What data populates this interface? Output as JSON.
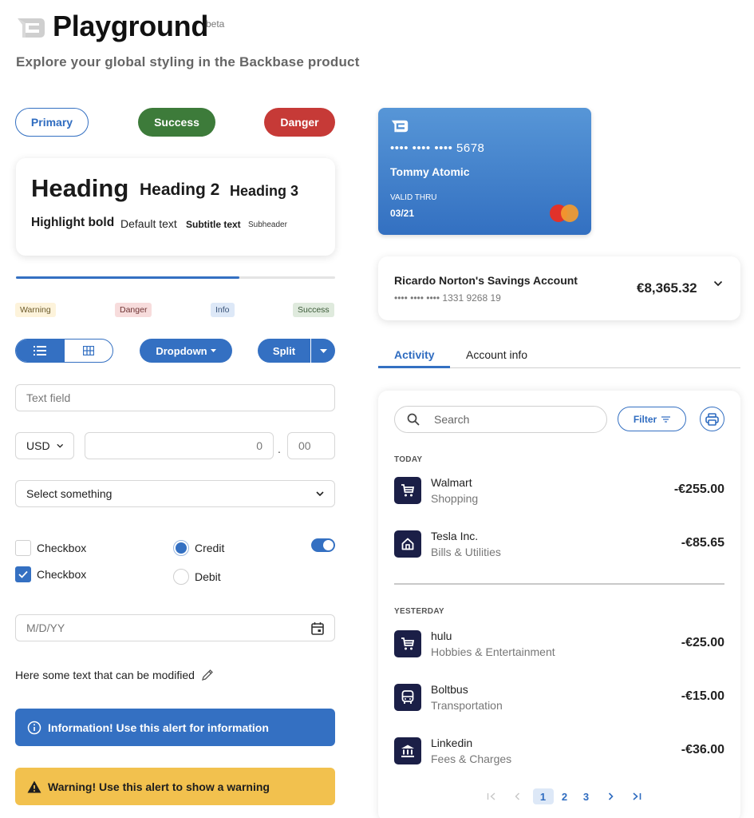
{
  "header": {
    "title": "Playground",
    "badge": "beta",
    "subtitle": "Explore your global styling in the Backbase product"
  },
  "buttons": {
    "primary": "Primary",
    "success": "Success",
    "danger": "Danger"
  },
  "typography": {
    "heading": "Heading",
    "heading2": "Heading 2",
    "heading3": "Heading 3",
    "highlight": "Highlight bold",
    "default": "Default text",
    "subtitle": "Subtitle text",
    "subheader": "Subheader"
  },
  "progress": {
    "value_percent": 70
  },
  "badges": {
    "warning": "Warning",
    "danger": "Danger",
    "info": "Info",
    "success": "Success"
  },
  "controls": {
    "view_toggle": {
      "options": [
        "list-icon",
        "grid-icon"
      ],
      "selected": "list-icon"
    },
    "dropdown_label": "Dropdown",
    "split_label": "Split"
  },
  "form": {
    "text_field_placeholder": "Text field",
    "currency": "USD",
    "amount_placeholder": "0",
    "decimal_separator": ".",
    "cents_placeholder": "00",
    "select_value": "Select something",
    "checkboxes": [
      {
        "label": "Checkbox",
        "checked": false
      },
      {
        "label": "Checkbox",
        "checked": true
      }
    ],
    "radios": [
      {
        "label": "Credit",
        "selected": true
      },
      {
        "label": "Debit",
        "selected": false
      }
    ],
    "switch_on": true,
    "date_placeholder": "M/D/YY",
    "editable_text": "Here some text that can be modified"
  },
  "alerts": {
    "info": "Information! Use this alert for information",
    "warning": "Warning! Use this alert to show a warning"
  },
  "payment_card": {
    "number": "•••• •••• •••• 5678",
    "holder": "Tommy Atomic",
    "valid_label": "VALID THRU",
    "expiry": "03/21",
    "network": "mastercard"
  },
  "account": {
    "name": "Ricardo Norton's Savings Account",
    "number": "•••• •••• •••• 1331 9268 19",
    "balance": "€8,365.32"
  },
  "tabs": [
    {
      "label": "Activity",
      "active": true
    },
    {
      "label": "Account info",
      "active": false
    }
  ],
  "activity": {
    "search_placeholder": "Search",
    "filter_label": "Filter",
    "groups": [
      {
        "label": "TODAY",
        "transactions": [
          {
            "name": "Walmart",
            "category": "Shopping",
            "amount": "-€255.00",
            "icon": "cart-icon"
          },
          {
            "name": "Tesla Inc.",
            "category": "Bills & Utilities",
            "amount": "-€85.65",
            "icon": "home-icon"
          }
        ]
      },
      {
        "label": "YESTERDAY",
        "transactions": [
          {
            "name": "hulu",
            "category": "Hobbies & Entertainment",
            "amount": "-€25.00",
            "icon": "cart-icon"
          },
          {
            "name": "Boltbus",
            "category": "Transportation",
            "amount": "-€15.00",
            "icon": "bus-icon"
          },
          {
            "name": "Linkedin",
            "category": "Fees & Charges",
            "amount": "-€36.00",
            "icon": "bank-icon"
          }
        ]
      }
    ],
    "pagination": {
      "pages": [
        "1",
        "2",
        "3"
      ],
      "current": "1"
    }
  },
  "colors": {
    "primary": "#3470c2",
    "success": "#3d7b3a",
    "danger": "#c63a37",
    "warning": "#f2c14e",
    "tx_icon_bg": "#1b1f47"
  }
}
